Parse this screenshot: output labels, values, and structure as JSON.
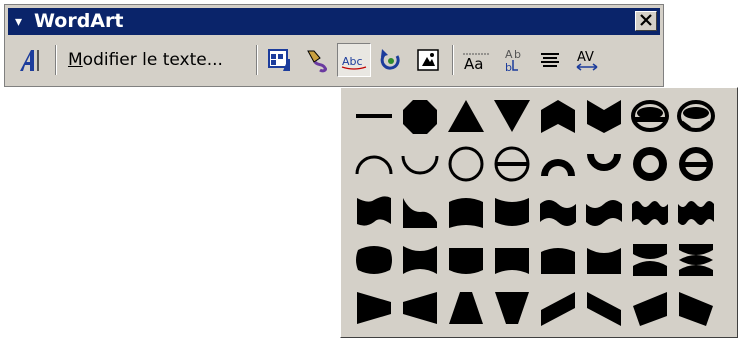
{
  "toolbar": {
    "title": "WordArt",
    "menu_arrow": "▾",
    "edit_text_mnemonic": "M",
    "edit_text_rest": "odifier le texte...",
    "close_icon": "close-icon"
  },
  "toolbar_buttons": [
    {
      "name": "insert-wordart-icon",
      "pressed": false
    },
    {
      "name": "wordart-gallery-icon",
      "pressed": false
    },
    {
      "name": "format-wordart-icon",
      "pressed": false
    },
    {
      "name": "wordart-shape-icon",
      "pressed": true
    },
    {
      "name": "free-rotate-icon",
      "pressed": false
    },
    {
      "name": "text-wrapping-icon",
      "pressed": false
    },
    {
      "name": "same-letter-heights-icon",
      "pressed": false
    },
    {
      "name": "vertical-text-icon",
      "pressed": false
    },
    {
      "name": "alignment-icon",
      "pressed": false
    },
    {
      "name": "character-spacing-icon",
      "pressed": false
    }
  ],
  "shape_palette": {
    "rows": [
      [
        "plain-text",
        "stop",
        "triangle-up",
        "triangle-down",
        "chevron-up",
        "chevron-down",
        "ring-inside",
        "ring-outside"
      ],
      [
        "arch-up-curve",
        "arch-down-curve",
        "circle-curve",
        "button-curve",
        "arch-up-pour",
        "arch-down-pour",
        "circle-pour",
        "button-pour"
      ],
      [
        "curve-up",
        "curve-down",
        "can-up",
        "can-down",
        "wave-1",
        "wave-2",
        "double-wave-1",
        "double-wave-2"
      ],
      [
        "inflate",
        "deflate",
        "inflate-bottom",
        "deflate-bottom",
        "inflate-top",
        "deflate-top",
        "deflate-inflate",
        "deflate-inflate-deflate"
      ],
      [
        "fade-right",
        "fade-left",
        "fade-up",
        "fade-down",
        "slant-up",
        "slant-down",
        "cascade-up",
        "cascade-down"
      ]
    ]
  },
  "colors": {
    "face": "#d4d0c8",
    "title_bar": "#0a246a",
    "title_text": "#ffffff",
    "icon_blue": "#1c3c9c",
    "shape_fill": "#000000"
  }
}
